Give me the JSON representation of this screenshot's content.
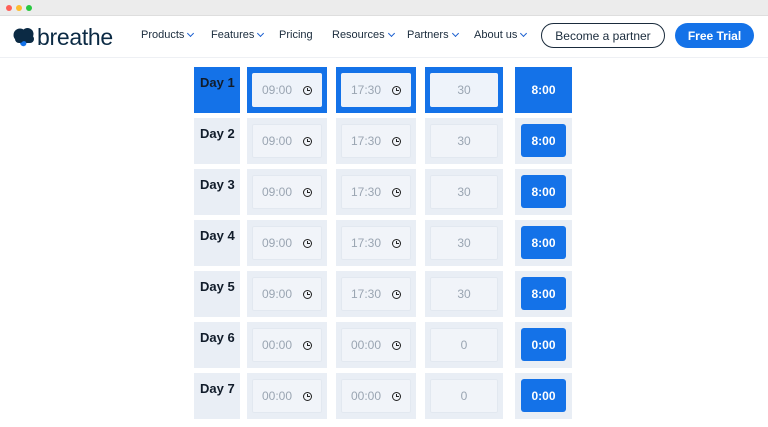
{
  "brand": {
    "name": "breathe",
    "color": "#0b2a44",
    "accent": "#1472e8"
  },
  "nav": {
    "items": [
      {
        "label": "Products",
        "dropdown": true
      },
      {
        "label": "Features",
        "dropdown": true
      },
      {
        "label": "Pricing",
        "dropdown": false
      },
      {
        "label": "Resources",
        "dropdown": true
      },
      {
        "label": "Partners",
        "dropdown": true
      },
      {
        "label": "About us",
        "dropdown": true
      }
    ],
    "partner_button": "Become a partner",
    "trial_button": "Free Trial"
  },
  "schedule": {
    "rows": [
      {
        "day": "Day 1",
        "start": "09:00",
        "end": "17:30",
        "break": "30",
        "total": "8:00",
        "active": true
      },
      {
        "day": "Day 2",
        "start": "09:00",
        "end": "17:30",
        "break": "30",
        "total": "8:00",
        "active": false
      },
      {
        "day": "Day 3",
        "start": "09:00",
        "end": "17:30",
        "break": "30",
        "total": "8:00",
        "active": false
      },
      {
        "day": "Day 4",
        "start": "09:00",
        "end": "17:30",
        "break": "30",
        "total": "8:00",
        "active": false
      },
      {
        "day": "Day 5",
        "start": "09:00",
        "end": "17:30",
        "break": "30",
        "total": "8:00",
        "active": false
      },
      {
        "day": "Day 6",
        "start": "00:00",
        "end": "00:00",
        "break": "0",
        "total": "0:00",
        "active": false
      },
      {
        "day": "Day 7",
        "start": "00:00",
        "end": "00:00",
        "break": "0",
        "total": "0:00",
        "active": false
      }
    ]
  }
}
